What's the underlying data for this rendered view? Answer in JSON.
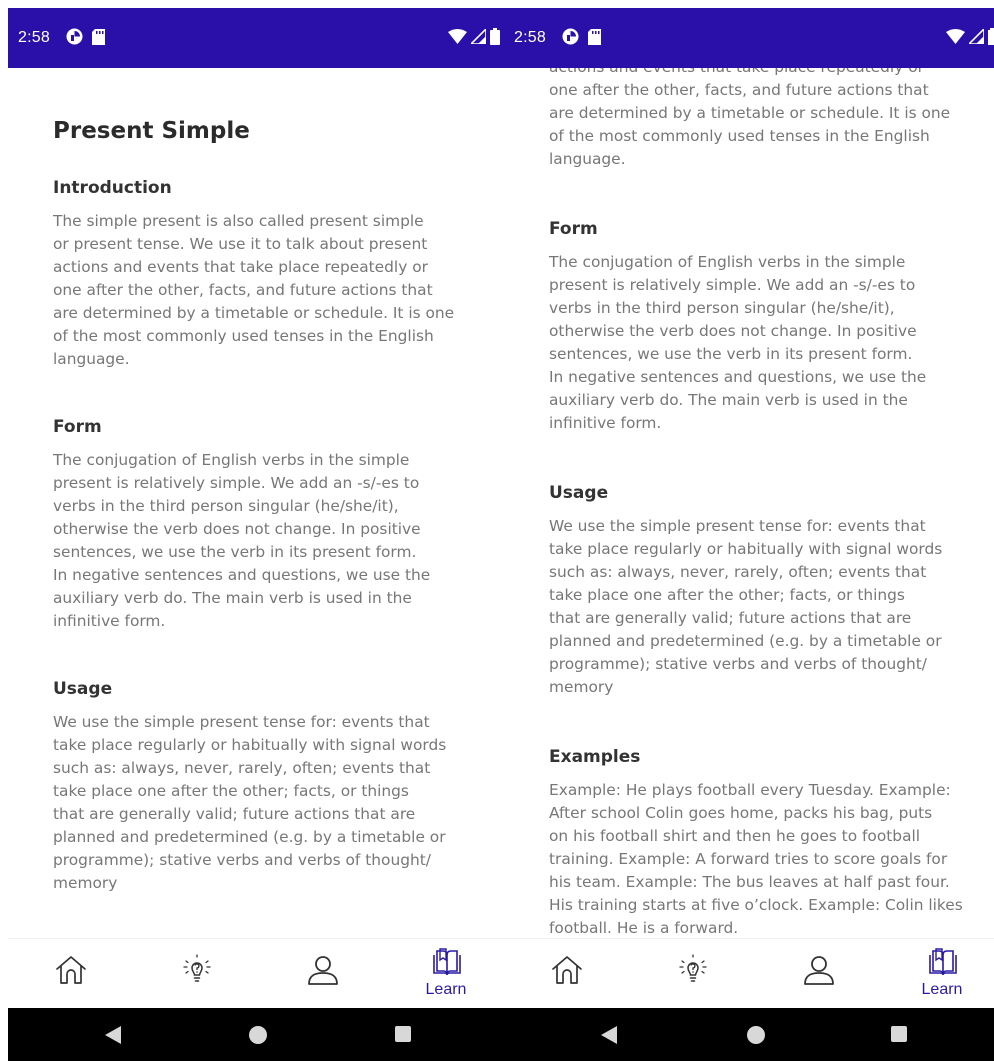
{
  "status_bar": {
    "time": "2:58"
  },
  "article": {
    "title": "Present Simple",
    "sections": [
      {
        "heading": "Introduction",
        "text": "The simple present is also called present simple\nor present tense. We use it to talk about present\nactions and events that take place repeatedly or\none after the other, facts, and future actions that\nare determined by a timetable or schedule. It is one\nof the most commonly used tenses in the English\nlanguage."
      },
      {
        "heading": "Form",
        "text": "The conjugation of English verbs in the simple\npresent is relatively simple. We add an -s/-es to\nverbs in the third person singular (he/she/it),\notherwise the verb does not change. In positive\nsentences, we use the verb in its present form.\nIn negative sentences and questions, we use the\nauxiliary verb do. The main verb is used in the\ninfinitive form."
      },
      {
        "heading": "Usage",
        "text": "We use the simple present tense for:  events that\ntake place regularly or habitually with signal words\nsuch as: always, never, rarely, often; events that\ntake place one after the other; facts, or things\nthat are generally valid; future actions that are\nplanned and predetermined (e.g. by a timetable or\nprogramme); stative verbs and verbs of thought/\nmemory"
      },
      {
        "heading": "Examples",
        "text": "Example: He plays football every Tuesday. Example:\nAfter school Colin goes home, packs his bag, puts\non his football shirt and then he goes to football\ntraining. Example: A forward tries to score goals for\nhis team. Example: The bus leaves at half past four.\nHis training starts at five o’clock. Example: Colin likes\nfootball. He is a forward."
      }
    ]
  },
  "right_intro_tail": "actions and events that take place repeatedly or\none after the other, facts, and future actions that\nare determined by a timetable or schedule. It is one\nof the most commonly used tenses in the English\nlanguage.",
  "bottom_nav": {
    "learn_label": "Learn"
  },
  "colors": {
    "status_bar": "#2a10a8",
    "accent": "#2a1ba3",
    "heading": "#333333",
    "body_text": "#777777"
  },
  "icons": [
    "home-icon",
    "lightbulb-icon",
    "profile-icon",
    "learn-book-icon",
    "back-icon",
    "home-circle-icon",
    "recents-icon",
    "wifi-icon",
    "cellular-icon",
    "battery-icon"
  ]
}
